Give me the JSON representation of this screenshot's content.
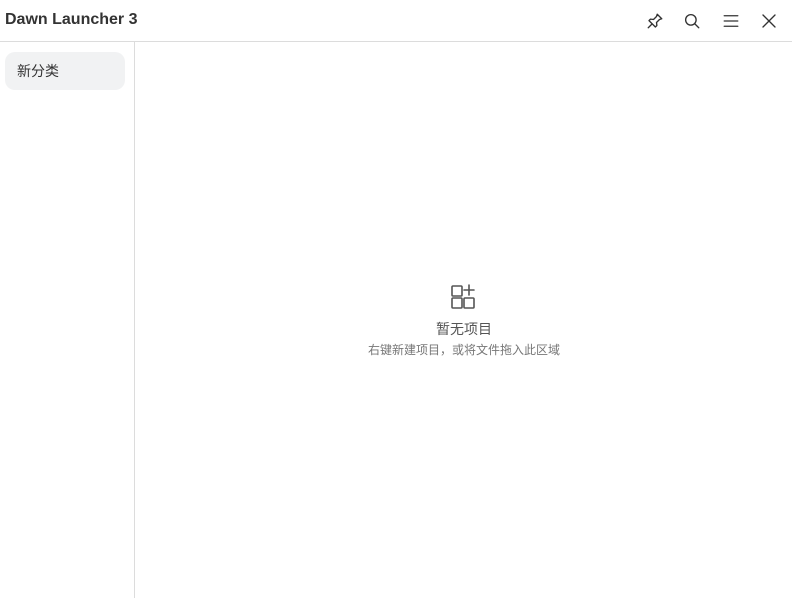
{
  "app": {
    "title": "Dawn Launcher 3"
  },
  "toolbar": {
    "icons": [
      "pin-icon",
      "search-icon",
      "menu-icon",
      "close-icon"
    ]
  },
  "sidebar": {
    "items": [
      {
        "label": "新分类",
        "selected": true
      }
    ]
  },
  "main": {
    "empty": {
      "icon": "add-grid-icon",
      "title": "暂无项目",
      "hint": "右键新建项目，或将文件拖入此区域"
    }
  },
  "colors": {
    "border": "#dcdcdc",
    "selected_bg": "#f1f2f3",
    "icon": "#555555"
  }
}
